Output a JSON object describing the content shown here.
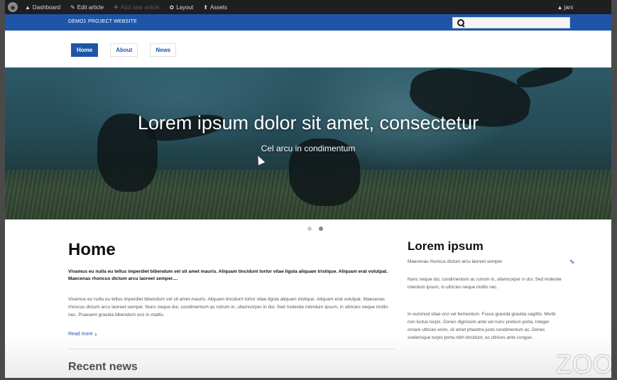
{
  "admin_bar": {
    "items": [
      {
        "icon": "dashboard-icon",
        "label": "Dashboard",
        "enabled": true
      },
      {
        "icon": "edit-icon",
        "label": "Edit article",
        "enabled": true
      },
      {
        "icon": "add-icon",
        "label": "Add new article",
        "enabled": false
      },
      {
        "icon": "layout-icon",
        "label": "Layout",
        "enabled": true
      },
      {
        "icon": "assets-icon",
        "label": "Assets",
        "enabled": true
      }
    ],
    "user": "jani"
  },
  "site_bar": {
    "site_name": "DEMO1 PROJECT WEBSITE",
    "search_placeholder": "",
    "color": "#1f55a8"
  },
  "nav": {
    "items": [
      {
        "label": "Home",
        "active": true
      },
      {
        "label": "About",
        "active": false
      },
      {
        "label": "News",
        "active": false
      }
    ]
  },
  "hero": {
    "title": "Lorem ipsum dolor sit amet, consectetur",
    "subtitle": "Cel arcu in condimentum",
    "slides": 2,
    "active_slide": 2
  },
  "main": {
    "title": "Home",
    "lead": "Vivamus eu nulla eu tellus imperdiet bibendum vel sit amet mauris. Aliquam tincidunt tortor vitae ligula aliquam tristique. Aliquam erat volutpat. Maecenas rhoncus dictum arcu laoreet semper....",
    "body": "Vivamus eu nulla eu tellus imperdiet bibendum vel sit amet mauris. Aliquam tincidunt tortor vitae ligula aliquam tristique. Aliquam erat volutpat. Maecenas rhoncus dictum arcu laoreet semper. Nunc neque dui, condimentum ac rutrum in, ullamcorper in dui. Sed molestie interdum ipsum, in ultricies neque mollis nec. Praesent gravida bibendum orci in mattis.",
    "read_more": "Read more",
    "recent_title": "Recent news"
  },
  "sidebar": {
    "title": "Lorem ipsum",
    "p1": "Maecenas rhoncus dictum arcu laoreet semper.",
    "p2": "Nunc neque dui, condimentum ac rutrum in, ullamcorper in dui. Sed molestie interdum ipsum, in ultricies neque mollis nec.",
    "p3": "In euismod vitae orci vel fermentum. Fusce gravida gravida sagittis. Morbi non luctus turpis. Donec dignissim ante vel nunc pretium porta. Integer ornare ultrices enim, sit amet pharetra justo condimentum ac. Donec scelerisque turpis porta nibh tincidunt, ac ultrices ante congue."
  },
  "watermark": "ZOO"
}
